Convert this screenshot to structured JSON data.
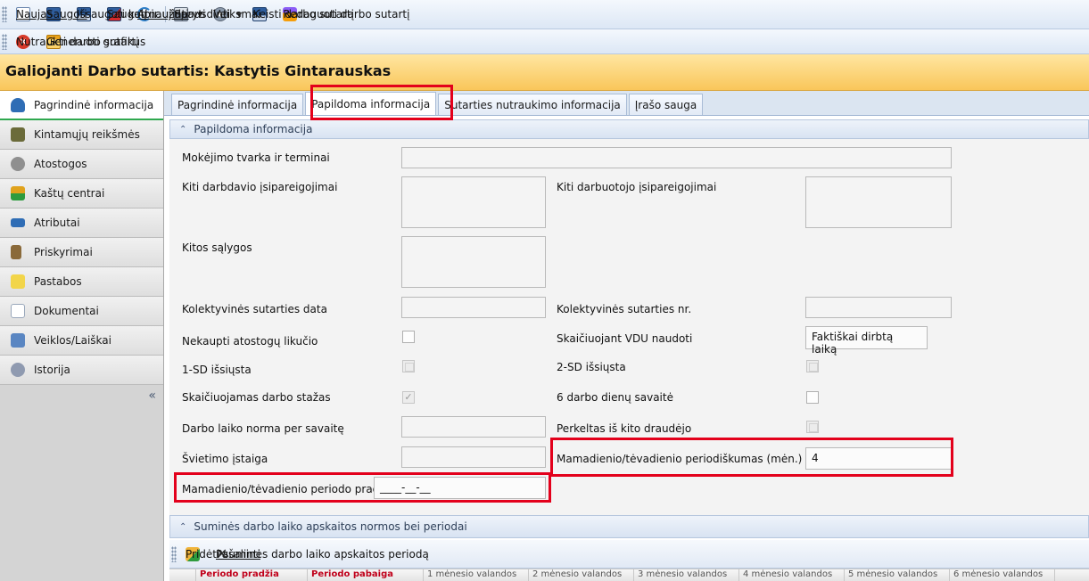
{
  "toolbar": {
    "buttons": [
      {
        "label": "Naujas",
        "icon": "new-document-icon"
      },
      {
        "label": "Saugoti",
        "icon": "save-icon"
      },
      {
        "label": "Išsaugoti kaip...",
        "icon": "save-as-icon"
      },
      {
        "label": "Saugoti ir uždaryti",
        "icon": "save-close-icon"
      },
      {
        "label": "Atnaujinti",
        "icon": "refresh-icon"
      },
      {
        "label": "Spausdinti",
        "icon": "printer-icon"
      },
      {
        "label": "Veiksmai",
        "icon": "gear-icon"
      },
      {
        "label": "Keisti darbo sutartį",
        "icon": "save-change-icon"
      },
      {
        "label": "Redaguoti darbo sutartį",
        "icon": "edit-contract-icon"
      }
    ]
  },
  "toolbar2": {
    "terminate": "Nutraukti darbo sutartį",
    "generate": "Generuoti grafikus"
  },
  "title": "Galiojanti Darbo sutartis: Kastytis Gintarauskas",
  "sidebar": {
    "items": [
      {
        "label": "Pagrindinė informacija",
        "icon": "database-icon",
        "color": "#2f6db5"
      },
      {
        "label": "Kintamųjų reikšmės",
        "icon": "pencil-book-icon",
        "color": "#6b6b3a"
      },
      {
        "label": "Atostogos",
        "icon": "palm-icon",
        "color": "#8f8f8f"
      },
      {
        "label": "Kaštų centrai",
        "icon": "money-icon",
        "color": "#e0a21c"
      },
      {
        "label": "Atributai",
        "icon": "attributes-icon",
        "color": "#2f6db5"
      },
      {
        "label": "Priskyrimai",
        "icon": "pillar-icon",
        "color": "#8a6a3a"
      },
      {
        "label": "Pastabos",
        "icon": "note-icon",
        "color": "#f2d54a"
      },
      {
        "label": "Dokumentai",
        "icon": "documents-icon",
        "color": "#9aa8bb"
      },
      {
        "label": "Veiklos/Laiškai",
        "icon": "mail-icon",
        "color": "#5a86c2"
      },
      {
        "label": "Istorija",
        "icon": "history-icon",
        "color": "#8f9ab0"
      }
    ],
    "collapse": "«"
  },
  "tabs": [
    {
      "label": "Pagrindinė informacija",
      "active": false
    },
    {
      "label": "Papildoma informacija",
      "active": true
    },
    {
      "label": "Sutarties nutraukimo informacija",
      "active": false
    },
    {
      "label": "Įrašo sauga",
      "active": false
    }
  ],
  "section1": "Papildoma informacija",
  "section2": "Suminės darbo laiko apskaitos normos bei periodai",
  "form": {
    "mokejimo": "Mokėjimo tvarka ir terminai",
    "kiti_darbdavio": "Kiti darbdavio įsipareigojimai",
    "kiti_darbuotojo": "Kiti darbuotojo įsipareigojimai",
    "kitos_salygos": "Kitos sąlygos",
    "kolektyvines_data": "Kolektyvinės sutarties data",
    "kolektyvines_nr": "Kolektyvinės sutarties nr.",
    "nekaupti": "Nekaupti atostogų likučio",
    "vdu": "Skaičiuojant VDU naudoti",
    "vdu_value": "Faktiškai dirbtą laiką",
    "sd1": "1-SD išsiųsta",
    "sd2": "2-SD išsiųsta",
    "stazas": "Skaičiuojamas darbo stažas",
    "sesi": "6 darbo dienų savaitė",
    "norma": "Darbo laiko norma per savaitę",
    "perkeltas": "Perkeltas iš kito draudėjo",
    "svietimo": "Švietimo įstaiga",
    "periodiskumas": "Mamadienio/tėvadienio periodiškumas (mėn.)",
    "periodiskumas_value": "4",
    "pradzia": "Mamadienio/tėvadienio periodo pradžia",
    "pradzia_value": "____-__-__"
  },
  "bottom": {
    "add": "Pridėti suminės darbo laiko apskaitos periodą",
    "remove": "Pašalinti",
    "columns": [
      "Periodo pradžia",
      "Periodo pabaiga",
      "1 mėnesio valandos",
      "2 mėnesio valandos",
      "3 mėnesio valandos",
      "4 mėnesio valandos",
      "5 mėnesio valandos",
      "6 mėnesio valandos"
    ]
  }
}
